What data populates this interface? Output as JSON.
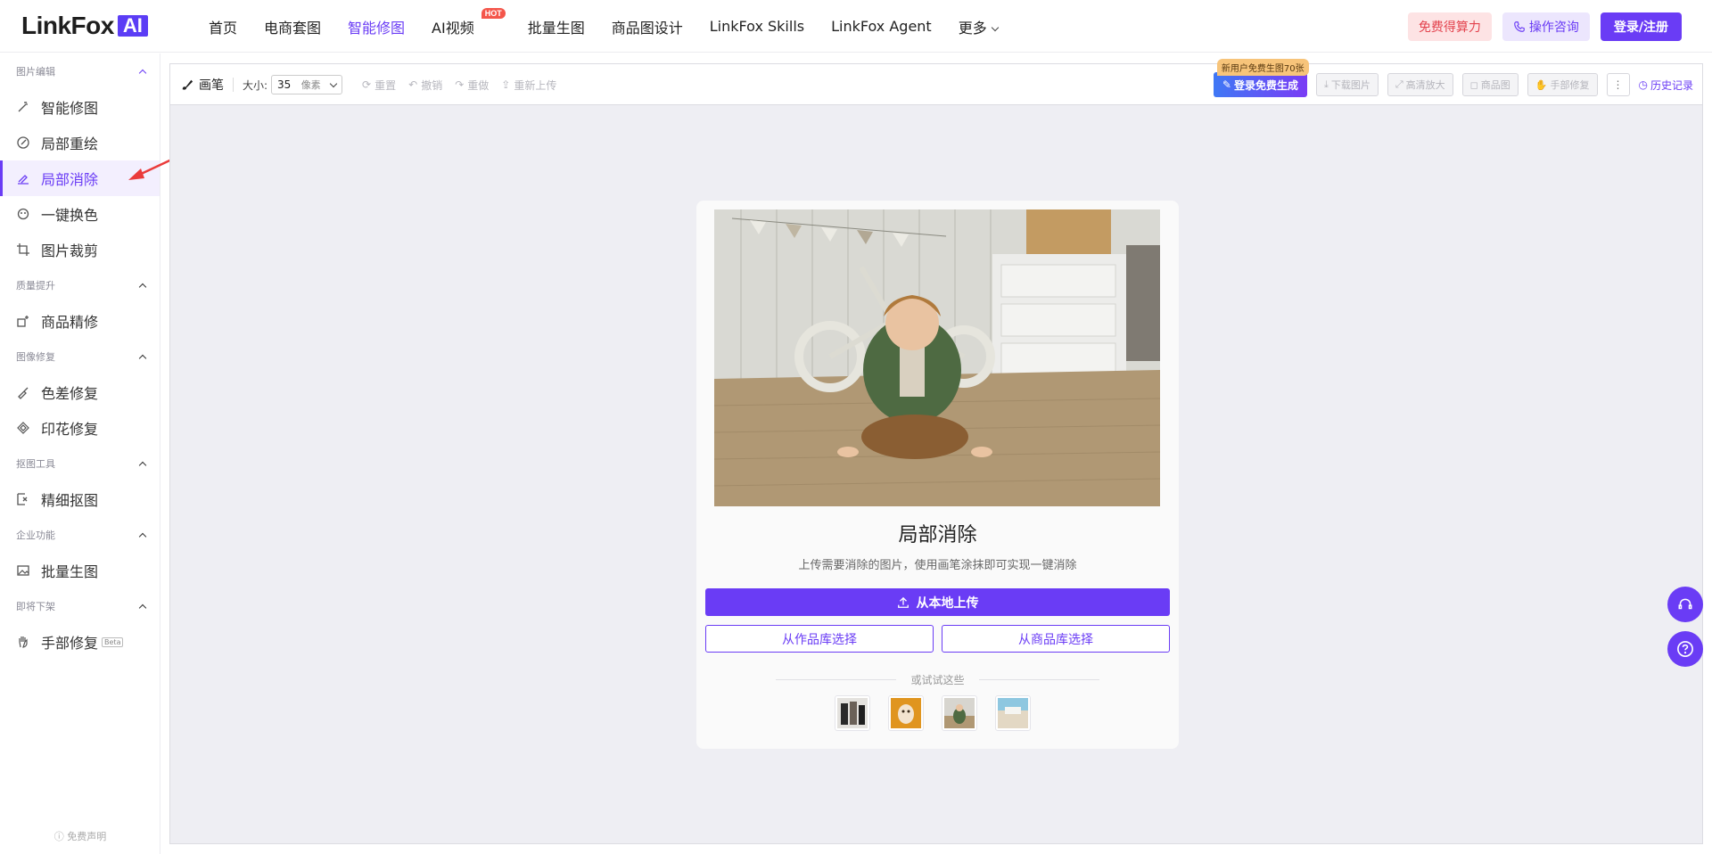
{
  "logo": {
    "text": "LinkFox",
    "badge": "AI"
  },
  "nav": {
    "items": [
      {
        "label": "首页",
        "active": false
      },
      {
        "label": "电商套图",
        "active": false
      },
      {
        "label": "智能修图",
        "active": true
      },
      {
        "label": "AI视频",
        "active": false,
        "badge": "HOT"
      },
      {
        "label": "批量生图",
        "active": false
      },
      {
        "label": "商品图设计",
        "active": false
      },
      {
        "label": "LinkFox Skills",
        "active": false
      },
      {
        "label": "LinkFox Agent",
        "active": false
      },
      {
        "label": "更多",
        "active": false
      }
    ]
  },
  "header_actions": {
    "free": "免费得算力",
    "consult": "操作咨询",
    "login": "登录/注册"
  },
  "sidebar": {
    "sections": [
      {
        "title": "图片编辑",
        "items": [
          "智能修图",
          "局部重绘",
          "局部消除",
          "一键换色",
          "图片裁剪"
        ]
      },
      {
        "title": "质量提升",
        "items": [
          "商品精修"
        ]
      },
      {
        "title": "图像修复",
        "items": [
          "色差修复",
          "印花修复"
        ]
      },
      {
        "title": "抠图工具",
        "items": [
          "精细抠图"
        ]
      },
      {
        "title": "企业功能",
        "items": [
          "批量生图"
        ]
      },
      {
        "title": "即将下架",
        "items": [
          "手部修复"
        ]
      }
    ],
    "active_item": "局部消除",
    "beta_tag": "Beta",
    "disclaimer": "免费声明"
  },
  "toolbar": {
    "brush": "画笔",
    "size_label": "大小:",
    "size_value": "35",
    "size_unit": "像素",
    "reset": "重置",
    "undo": "撤销",
    "redo": "重做",
    "reupload": "重新上传",
    "generate": "登录免费生成",
    "new_user_tag": "新用户免费生图70张",
    "download": "下载图片",
    "upscale": "高清放大",
    "product": "商品图",
    "hand_fix": "手部修复",
    "history": "历史记录"
  },
  "card": {
    "title": "局部消除",
    "subtitle": "上传需要消除的图片，使用画笔涂抹即可实现一键消除",
    "upload": "从本地上传",
    "from_works": "从作品库选择",
    "from_products": "从商品库选择",
    "try_label": "或试试这些"
  },
  "colors": {
    "accent": "#6a3cf5",
    "free_btn_bg": "#fde3e4",
    "free_btn_text": "#e3434e"
  }
}
